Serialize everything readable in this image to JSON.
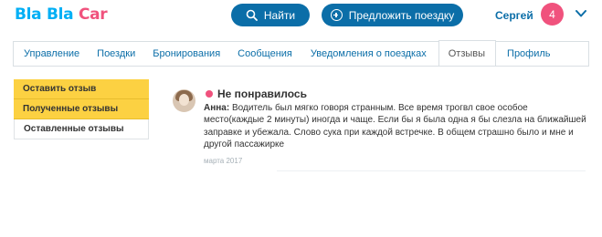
{
  "header": {
    "logo_part1": "Bla Bla ",
    "logo_part2": "Car",
    "find_label": "Найти",
    "offer_label": "Предложить поездку",
    "user_name": "Сергей",
    "notifications_count": "4",
    "accent_color": "#0b6ea8",
    "brand_color": "#00aff5",
    "badge_color": "#f0527d"
  },
  "tabs": [
    {
      "label": "Управление"
    },
    {
      "label": "Поездки"
    },
    {
      "label": "Бронирования"
    },
    {
      "label": "Сообщения"
    },
    {
      "label": "Уведомления о поездках"
    },
    {
      "label": "Отзывы",
      "active": true
    },
    {
      "label": "Профиль"
    }
  ],
  "sidebar": {
    "items": [
      {
        "label": "Оставить отзыв"
      },
      {
        "label": "Полученные отзывы"
      },
      {
        "label": "Оставленные отзывы"
      }
    ]
  },
  "review": {
    "title": "Не понравилось",
    "author": "Анна:",
    "text": "Водитель был мягко говоря странным. Все время трогвл свое особое место(каждые 2 минуты) иногда и чаще. Если бы я была одна я бы слезла на ближайшей заправке и убежала. Слово сука при каждой встречке. В общем страшно было и мне и другой пассажирке",
    "date": "марта 2017"
  }
}
